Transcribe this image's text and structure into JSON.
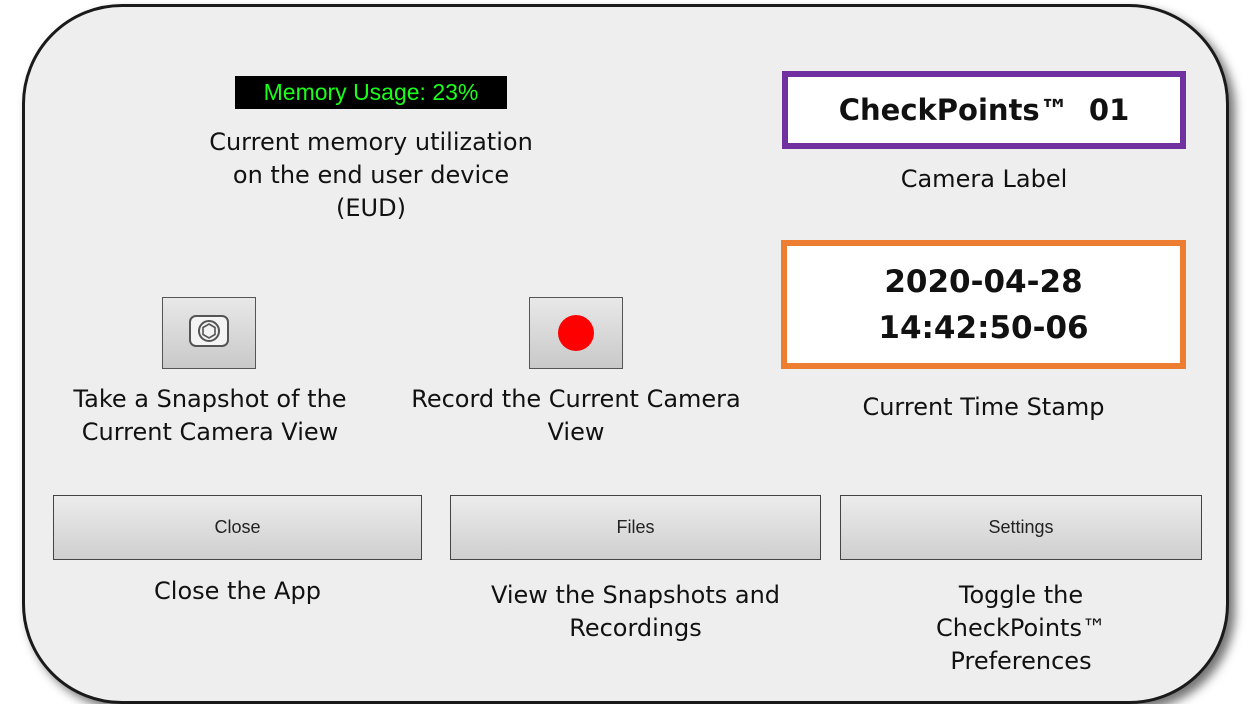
{
  "memory": {
    "badge_text": "Memory Usage: 23%",
    "caption_lines": [
      "Current memory utilization",
      "on the end user device",
      "(EUD)"
    ]
  },
  "camera_label": {
    "value": "CheckPoints™  01",
    "caption": "Camera Label",
    "border_color": "#7030a0"
  },
  "timestamp": {
    "date": "2020-04-28",
    "time": "14:42:50-06",
    "caption": "Current Time Stamp",
    "border_color": "#ed7d31"
  },
  "snapshot": {
    "icon": "camera-icon",
    "caption_lines": [
      "Take a Snapshot of the",
      "Current Camera View"
    ]
  },
  "record": {
    "icon": "record-icon",
    "icon_color": "#ff0000",
    "caption_lines": [
      "Record the Current Camera",
      "View"
    ]
  },
  "buttons": {
    "close": {
      "label": "Close",
      "caption_lines": [
        "Close the App"
      ]
    },
    "files": {
      "label": "Files",
      "caption_lines": [
        "View the Snapshots and",
        "Recordings"
      ]
    },
    "settings": {
      "label": "Settings",
      "caption_lines": [
        "Toggle the",
        "CheckPoints™",
        "Preferences"
      ]
    }
  }
}
